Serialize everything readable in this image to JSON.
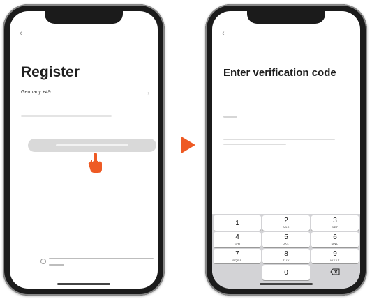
{
  "left_screen": {
    "back_icon": "chevron-left-icon",
    "title": "Register",
    "region": "Germany +49",
    "region_chevron": "chevron-right-icon",
    "pointer_icon": "hand-pointer-icon",
    "accent_color": "#ee5a24"
  },
  "right_screen": {
    "back_icon": "chevron-left-icon",
    "title": "Enter verification code",
    "keypad": {
      "keys": [
        {
          "digit": "1",
          "letters": ""
        },
        {
          "digit": "2",
          "letters": "ABC"
        },
        {
          "digit": "3",
          "letters": "DEF"
        },
        {
          "digit": "4",
          "letters": "GHI"
        },
        {
          "digit": "5",
          "letters": "JKL"
        },
        {
          "digit": "6",
          "letters": "MNO"
        },
        {
          "digit": "7",
          "letters": "PQRS"
        },
        {
          "digit": "8",
          "letters": "TUV"
        },
        {
          "digit": "9",
          "letters": "WXYZ"
        },
        {
          "digit": "0",
          "letters": ""
        }
      ],
      "delete_icon": "backspace-icon"
    }
  },
  "transition_arrow_icon": "play-arrow-icon"
}
